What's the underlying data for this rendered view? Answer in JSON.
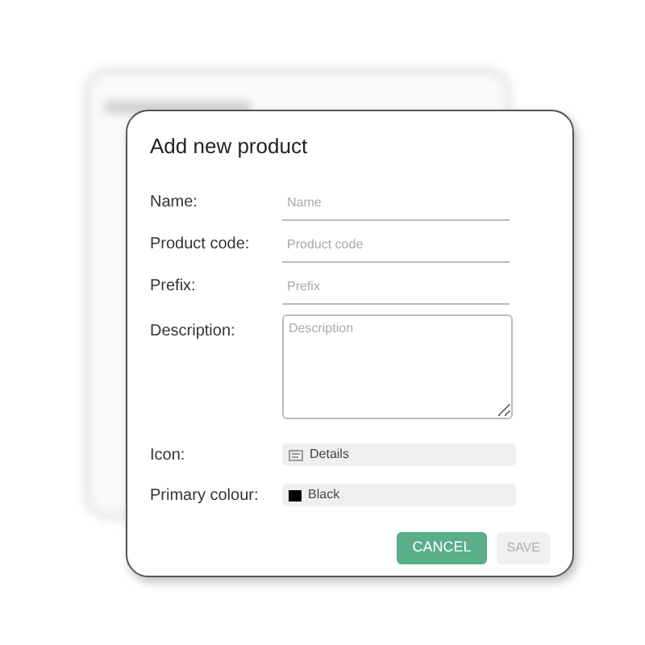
{
  "dialog": {
    "title": "Add new product",
    "fields": [
      {
        "kind": "line",
        "label": "Name:",
        "placeholder": "Name"
      },
      {
        "kind": "line",
        "label": "Product code:",
        "placeholder": "Product code"
      },
      {
        "kind": "line",
        "label": "Prefix:",
        "placeholder": "Prefix"
      },
      {
        "kind": "textarea",
        "label": "Description:",
        "placeholder": "Description"
      },
      {
        "kind": "icon-select",
        "label": "Icon:",
        "value": "Details"
      },
      {
        "kind": "color-select",
        "label": "Primary colour:",
        "value": "Black",
        "color": "#000000"
      }
    ],
    "buttons": [
      {
        "label": "CANCEL",
        "disabled": false
      },
      {
        "label": "SAVE",
        "disabled": true
      }
    ]
  }
}
